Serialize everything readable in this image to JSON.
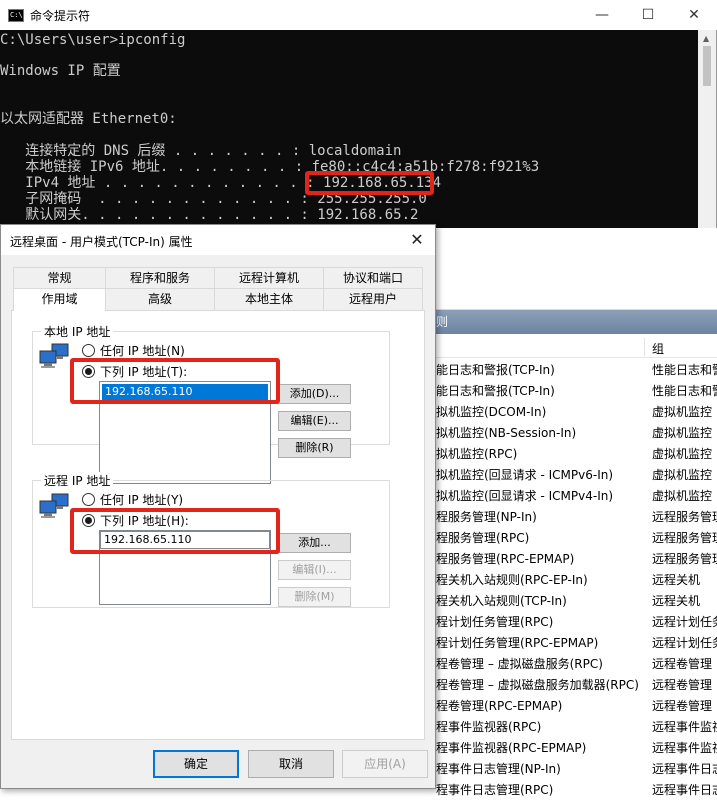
{
  "console": {
    "title": "命令提示符",
    "app_icon_text": "C:\\",
    "lines": [
      "C:\\Users\\user>ipconfig",
      "Windows IP 配置",
      "以太网适配器 Ethernet0:",
      "   连接特定的 DNS 后缀 . . . . . . . : localdomain",
      "   本地链接 IPv6 地址. . . . . . . . : fe80::c4c4:a51b:f278:f921%3",
      "   IPv4 地址 . . . . . . . . . . . . : ",
      "   子网掩码  . . . . . . . . . . . . : 255.255.255.0",
      "   默认网关. . . . . . . . . . . . . : 192.168.65.2"
    ],
    "ipv4_value": "192.168.65.134",
    "controls": {
      "minimize": "—",
      "maximize": "☐",
      "close": "✕"
    }
  },
  "background": {
    "header": "则",
    "col_group": "组",
    "rows": [
      {
        "name": "能日志和警报(TCP-In)",
        "group": "性能日志和警报"
      },
      {
        "name": "能日志和警报(TCP-In)",
        "group": "性能日志和警报"
      },
      {
        "name": "拟机监控(DCOM-In)",
        "group": "虚拟机监控"
      },
      {
        "name": "拟机监控(NB-Session-In)",
        "group": "虚拟机监控"
      },
      {
        "name": "拟机监控(RPC)",
        "group": "虚拟机监控"
      },
      {
        "name": "拟机监控(回显请求 - ICMPv6-In)",
        "group": "虚拟机监控"
      },
      {
        "name": "拟机监控(回显请求 - ICMPv4-In)",
        "group": "虚拟机监控"
      },
      {
        "name": "程服务管理(NP-In)",
        "group": "远程服务管理"
      },
      {
        "name": "程服务管理(RPC)",
        "group": "远程服务管理"
      },
      {
        "name": "程服务管理(RPC-EPMAP)",
        "group": "远程服务管理"
      },
      {
        "name": "程关机入站规则(RPC-EP-In)",
        "group": "远程关机"
      },
      {
        "name": "程关机入站规则(TCP-In)",
        "group": "远程关机"
      },
      {
        "name": "程计划任务管理(RPC)",
        "group": "远程计划任务"
      },
      {
        "name": "程计划任务管理(RPC-EPMAP)",
        "group": "远程计划任务"
      },
      {
        "name": "程卷管理 – 虚拟磁盘服务(RPC)",
        "group": "远程卷管理"
      },
      {
        "name": "程卷管理 – 虚拟磁盘服务加载器(RPC)",
        "group": "远程卷管理"
      },
      {
        "name": "程卷管理(RPC-EPMAP)",
        "group": "远程卷管理"
      },
      {
        "name": "程事件监视器(RPC)",
        "group": "远程事件监视"
      },
      {
        "name": "程事件监视器(RPC-EPMAP)",
        "group": "远程事件监视"
      },
      {
        "name": "程事件日志管理(NP-In)",
        "group": "远程事件日志"
      },
      {
        "name": "程事件日志管理(RPC)",
        "group": "远程事件日志"
      }
    ]
  },
  "dialog": {
    "title": "远程桌面 - 用户模式(TCP-In) 属性",
    "close": "✕",
    "tabs_top": [
      "常规",
      "程序和服务",
      "远程计算机",
      "协议和端口"
    ],
    "tabs_bottom": [
      "作用域",
      "高级",
      "本地主体",
      "远程用户"
    ],
    "local": {
      "label": "本地 IP 地址",
      "any": "任何 IP 地址(N)",
      "these": "下列 IP 地址(T):",
      "entries": [
        "192.168.65.110"
      ],
      "add": "添加(D)...",
      "edit": "编辑(E)...",
      "remove": "删除(R)"
    },
    "remote": {
      "label": "远程 IP 地址",
      "any": "任何 IP 地址(Y)",
      "these": "下列 IP 地址(H):",
      "input_value": "192.168.65.110",
      "add": "添加...",
      "edit": "编辑(I)...",
      "remove": "删除(M)"
    },
    "ok": "确定",
    "cancel": "取消",
    "apply": "应用(A)"
  },
  "colors": {
    "highlight": "#e0261b",
    "selection": "#0078d7",
    "console_bg": "#0c0c0c"
  }
}
